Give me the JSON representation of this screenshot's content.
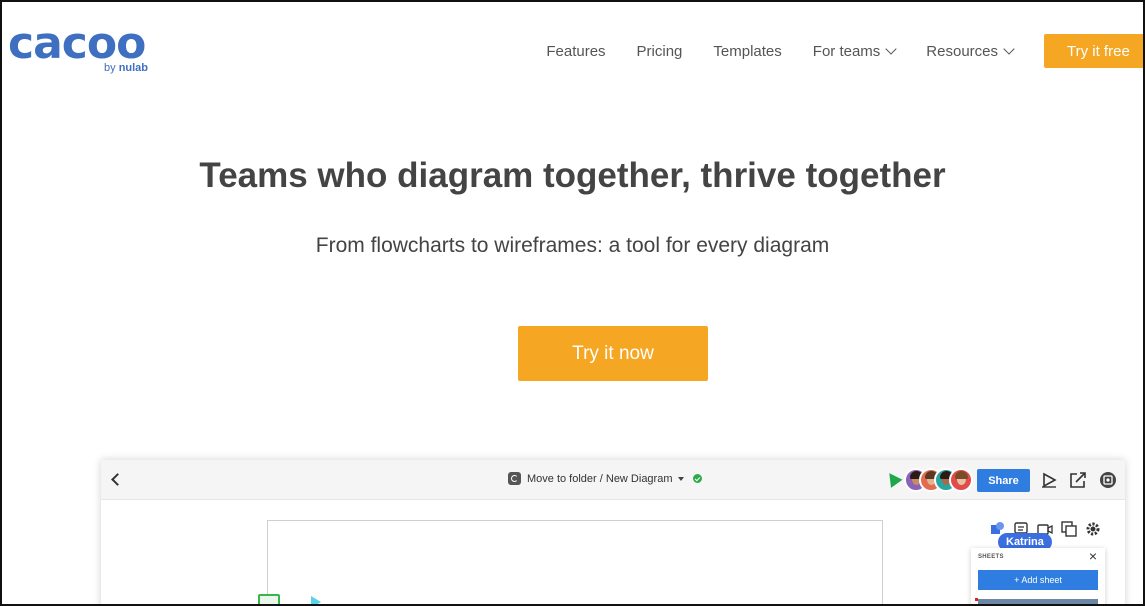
{
  "logo": {
    "wordmark": "cacoo",
    "by": "by",
    "brand": "nulab",
    "color": "#3f6fc0"
  },
  "nav": {
    "items": [
      {
        "label": "Features",
        "has_dropdown": false
      },
      {
        "label": "Pricing",
        "has_dropdown": false
      },
      {
        "label": "Templates",
        "has_dropdown": false
      },
      {
        "label": "For teams",
        "has_dropdown": true
      },
      {
        "label": "Resources",
        "has_dropdown": true
      }
    ],
    "cta": "Try it free"
  },
  "hero": {
    "title": "Teams who diagram together, thrive together",
    "subtitle": "From flowcharts to wireframes: a tool for every diagram",
    "cta": "Try it now"
  },
  "colors": {
    "accent": "#f5a623",
    "brand_blue": "#3f6fc0",
    "share_blue": "#2f7de1",
    "ok_green": "#2eaa4a"
  },
  "app_preview": {
    "breadcrumb": "Move to folder / New Diagram",
    "status_icon": "check-circle-icon",
    "share_label": "Share",
    "collaborator_label": "Katrina",
    "sheets_panel": {
      "title": "SHEETS",
      "add_label": "+ Add sheet"
    },
    "toolbar_icons": [
      "shapes-icon",
      "comment-icon",
      "video-icon",
      "duplicate-icon",
      "settings-icon"
    ]
  }
}
